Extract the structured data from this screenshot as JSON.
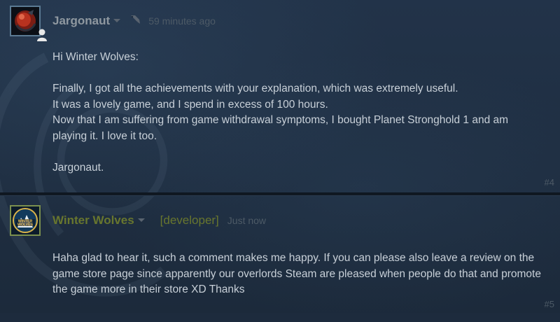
{
  "comments": [
    {
      "author": "Jargonaut",
      "timestamp": "59 minutes ago",
      "paragraphs": [
        "Hi Winter Wolves:",
        "Finally, I got all the achievements with your explanation, which was extremely useful.\nIt was a lovely game, and I spend in excess of 100 hours.\nNow that I am suffering from game withdrawal symptoms, I bought Planet Stronghold 1 and am playing it. I love it too.",
        "Jargonaut."
      ],
      "number": "#4",
      "icons": {
        "avatar": "avatar-image",
        "menu": "chevron-down-icon",
        "edited": "edit-icon",
        "status": "user-icon"
      }
    },
    {
      "author": "Winter Wolves",
      "tag": "[developer]",
      "timestamp": "Just now",
      "paragraphs": [
        "Haha glad to hear it, such a comment makes me happy. If you can please also leave a review on the game store page since apparently our overlords Steam are pleased when people do that and promote the game more in their store XD Thanks"
      ],
      "number": "#5",
      "avatar_text": {
        "line1": "WINTER",
        "line2": "WOLVES"
      },
      "icons": {
        "avatar": "avatar-image",
        "menu": "chevron-down-icon"
      }
    }
  ],
  "colors": {
    "background": "#1d2b3d",
    "author_default": "#8f98a0",
    "author_developer": "#68762e",
    "body_text": "#c8d0d8",
    "muted": "#4d5a66"
  }
}
